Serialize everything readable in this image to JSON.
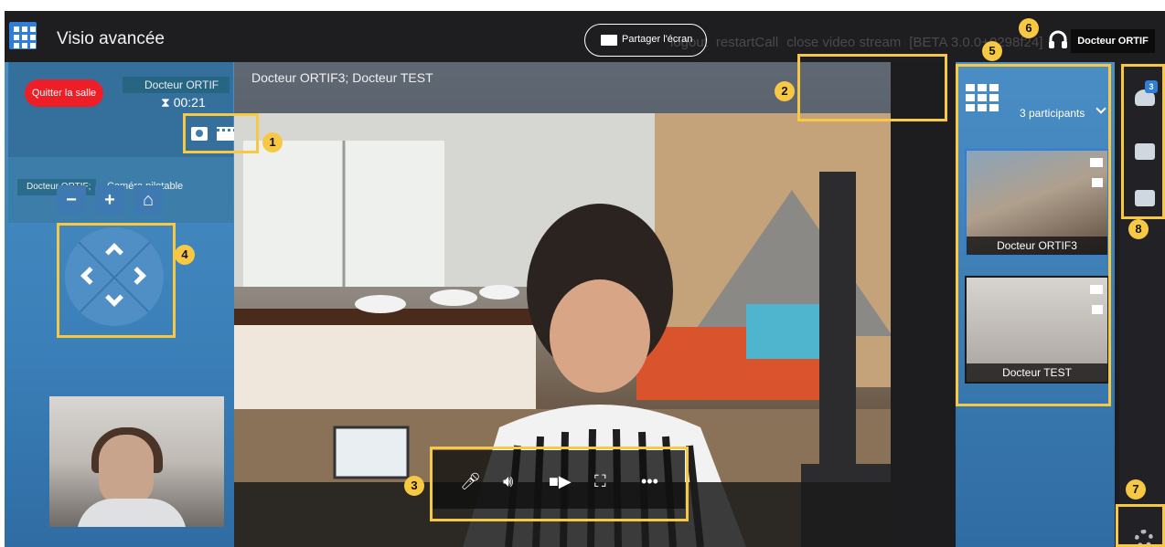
{
  "app": {
    "title": "Visio avancée",
    "nav": [
      "logout",
      "restartCall",
      "close video stream",
      "[BETA 3.0.0+0298f24]"
    ],
    "user": "Docteur ORTIF"
  },
  "call": {
    "quit_label": "Quitter la salle",
    "doctor": "Docteur ORTIF",
    "separator": ";",
    "timer": "00:21",
    "doctor_tag": "Docteur ORTIF;",
    "camera_label": "Caméra pilotable"
  },
  "video": {
    "names": "Docteur ORTIF3;   Docteur TEST",
    "share_label": "Partager l'écran"
  },
  "participants": {
    "count_label": "3 participants",
    "items": [
      "Docteur ORTIF3",
      "Docteur TEST"
    ]
  },
  "right_tools": {
    "badge": "3"
  },
  "callouts": [
    "1",
    "2",
    "3",
    "4",
    "5",
    "6",
    "7",
    "8"
  ],
  "colors": {
    "accent": "#f7c843",
    "quit": "#ee1e26",
    "panel": "#4a8ec5",
    "primary": "#2f7fd8"
  }
}
